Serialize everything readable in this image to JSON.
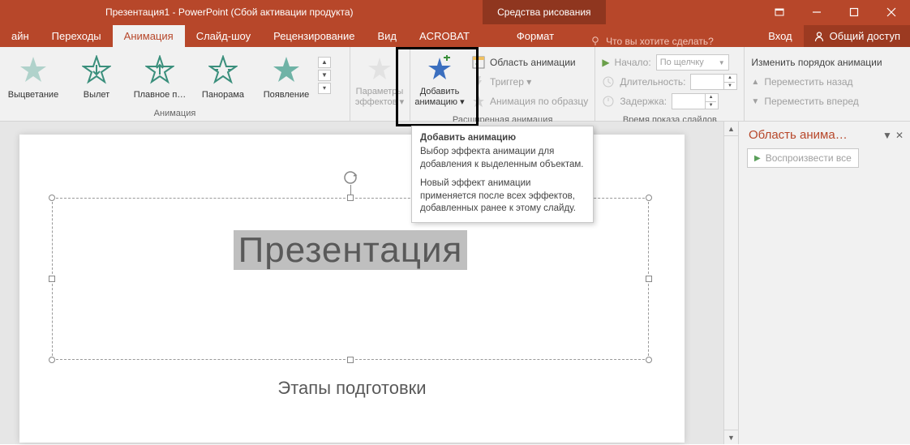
{
  "titlebar": {
    "title": "Презентация1 - PowerPoint (Сбой активации продукта)",
    "context_tab": "Средства рисования"
  },
  "tabs": {
    "t0": "айн",
    "t1": "Переходы",
    "t2": "Анимация",
    "t3": "Слайд-шоу",
    "t4": "Рецензирование",
    "t5": "Вид",
    "t6": "ACROBAT",
    "t7": "Формат",
    "tellme": "Что вы хотите сделать?",
    "signin": "Вход",
    "share": "Общий доступ"
  },
  "ribbon": {
    "animation_group": "Анимация",
    "gallery": {
      "i0": "Выцветание",
      "i1": "Вылет",
      "i2": "Плавное п…",
      "i3": "Панорама",
      "i4": "Появление"
    },
    "effect_options": "Параметры эффектов ▾",
    "add_anim": "Добавить анимацию ▾",
    "ext_group": "Расширенная анимация",
    "anim_pane": "Область анимации",
    "trigger": "Триггер ▾",
    "anim_painter": "Анимация по образцу",
    "timing_group": "Время показа слайдов",
    "start_label": "Начало:",
    "start_value": "По щелчку",
    "duration_label": "Длительность:",
    "delay_label": "Задержка:",
    "reorder_group": "Изменить порядок анимации",
    "move_back": "Переместить назад",
    "move_fwd": "Переместить вперед"
  },
  "tooltip": {
    "title": "Добавить анимацию",
    "p1": "Выбор эффекта анимации для добавления к выделенным объектам.",
    "p2": "Новый эффект анимации применяется после всех эффектов, добавленных ранее к этому слайду."
  },
  "slide": {
    "title": "Презентация",
    "subtitle": "Этапы подготовки"
  },
  "pane": {
    "title": "Область анима…",
    "play_all": "Воспроизвести все"
  }
}
